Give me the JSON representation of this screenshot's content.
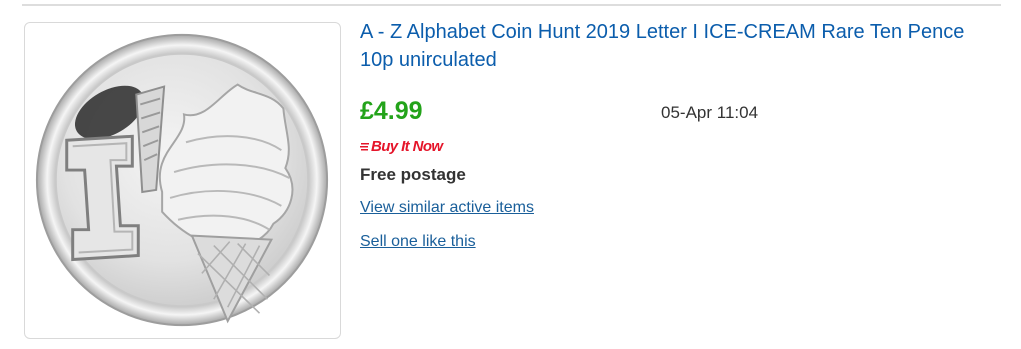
{
  "listing": {
    "title": "A - Z Alphabet Coin Hunt 2019 Letter I ICE-CREAM Rare Ten Pence 10p unirculated",
    "price": "£4.99",
    "time_left": "05-Apr 11:04",
    "format_badge": "Buy It Now",
    "shipping": "Free postage",
    "similar_link": "View similar active items",
    "sell_link": "Sell one like this",
    "image_icon": "coin-ice-cream-letter-i"
  },
  "colors": {
    "title": "#0b5dac",
    "price": "#23a31a",
    "badge": "#e5152a",
    "link": "#1a5f9a",
    "divider": "#dddddd"
  }
}
